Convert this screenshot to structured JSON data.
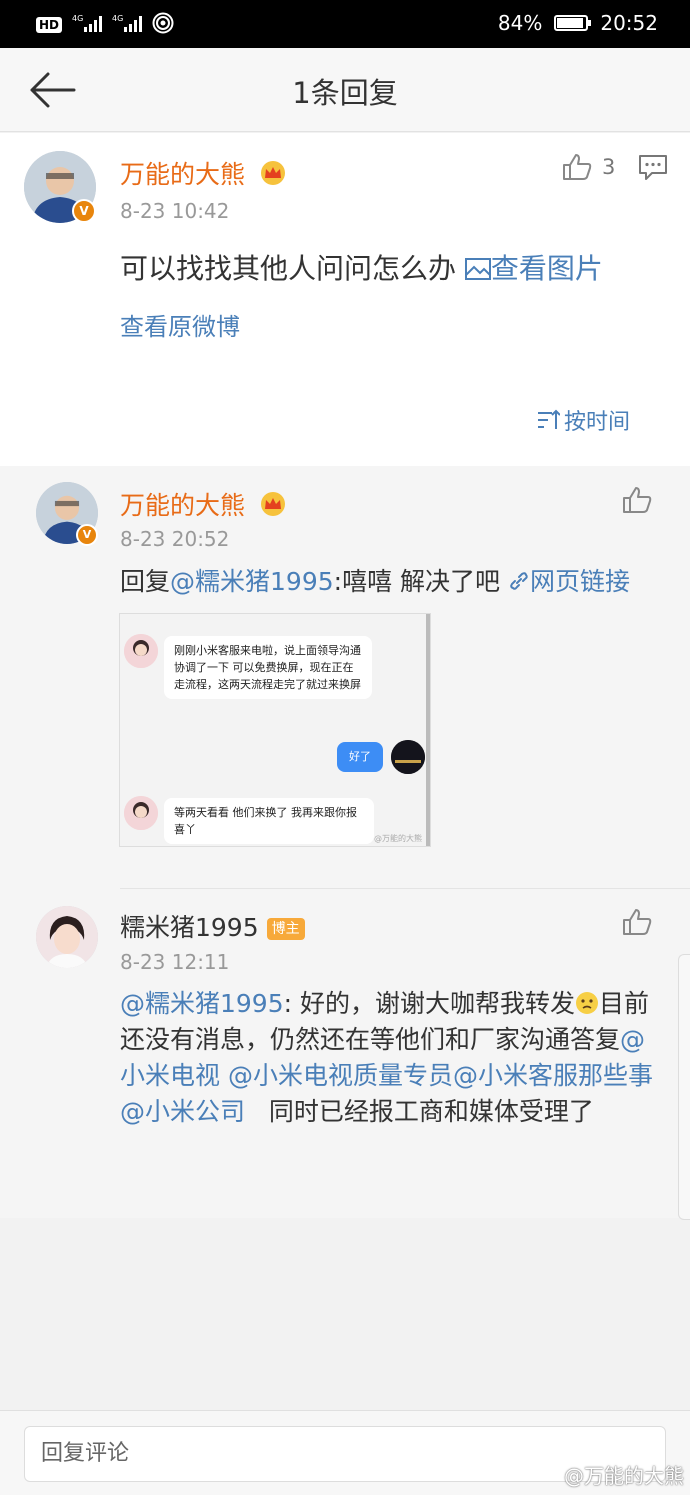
{
  "status_bar": {
    "left_labels": [
      "HD",
      "4G",
      "4G"
    ],
    "battery": "84%",
    "time": "20:52"
  },
  "nav": {
    "title": "1条回复"
  },
  "main_comment": {
    "username": "万能的大熊",
    "time": "8-23 10:42",
    "like_count": "3",
    "text": "可以找找其他人问问怎么办 ",
    "image_link": "查看图片",
    "view_original": "查看原微博",
    "sort_label": "按时间"
  },
  "replies": [
    {
      "username": "万能的大熊",
      "time": "8-23 20:52",
      "prefix": "回复",
      "mention": "@糯米猪1995",
      "text": ":嘻嘻 解决了吧 ",
      "web_link": "网页链接",
      "chat": {
        "msg1": "刚刚小米客服来电啦，说上面领导沟通协调了一下 可以免费换屏，现在正在走流程，这两天流程走完了就过来换屏",
        "msg2": "好了",
        "msg3": "等两天看看 他们来换了 我再来跟你报喜丫",
        "watermark": "@万能的大熊"
      }
    },
    {
      "username": "糯米猪1995",
      "badge": "博主",
      "time": "8-23 12:11",
      "mention": "@糯米猪1995",
      "text_a": ": 好的，谢谢大咖帮我转发",
      "text_b": "目前还没有消息，仍然还在等他们和厂家沟通答复",
      "mention_2": "@小米电视",
      "mention_3": "@小米电视质量专员",
      "mention_4": "@小米客服那些事",
      "mention_5": "@小米公司",
      "text_c": "同时已经报工商和媒体受理了"
    }
  ],
  "bottom": {
    "placeholder": "回复评论",
    "watermark": "@万能的大熊"
  },
  "colors": {
    "username": "#e86b17",
    "link": "#4a7fb8",
    "badge": "#f7a93a",
    "vip": "#e8850c"
  }
}
